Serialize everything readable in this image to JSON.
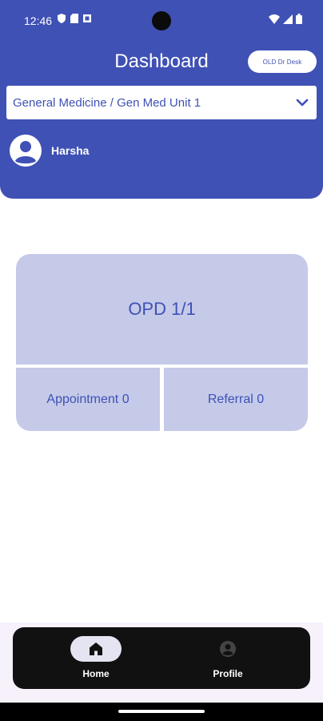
{
  "status_bar": {
    "time": "12:46",
    "left_icons": [
      "shield-icon",
      "sd-card-icon",
      "notification-icon"
    ],
    "right_icons": [
      "wifi-icon",
      "signal-icon",
      "battery-icon"
    ]
  },
  "header": {
    "title": "Dashboard",
    "desk_button_label": "OLD Dr Desk",
    "unit_selector": {
      "selected": "General Medicine / Gen Med Unit 1",
      "icon": "chevron-down-icon"
    },
    "user": {
      "name": "Harsha",
      "icon": "account-circle-icon"
    }
  },
  "dashboard_card": {
    "opd_label": "OPD 1/1",
    "appointment_label": "Appointment 0",
    "referral_label": "Referral 0"
  },
  "bottom_nav": {
    "items": [
      {
        "label": "Home",
        "icon": "home-icon",
        "active": true
      },
      {
        "label": "Profile",
        "icon": "profile-icon",
        "active": false
      }
    ]
  },
  "colors": {
    "primary": "#3f51b5",
    "card_background": "#c5cae9",
    "nav_background": "#111111",
    "active_pill": "#e4e4f3"
  }
}
